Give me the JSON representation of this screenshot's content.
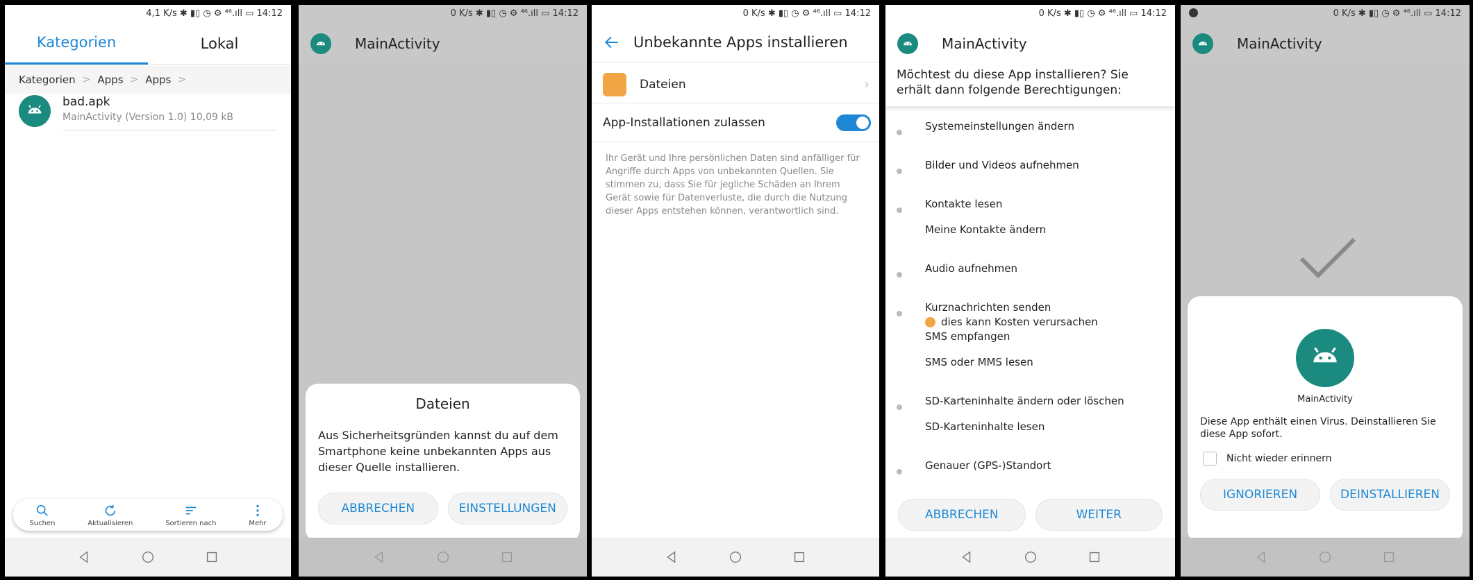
{
  "screen1": {
    "status": "4,1 K/s ✱ ▮▯ ◷ ⚙ ⁴⁶.ıll ▭ 14:12",
    "tabs": [
      "Kategorien",
      "Lokal"
    ],
    "breadcrumb": [
      "Kategorien",
      "Apps",
      "Apps"
    ],
    "file": {
      "name": "bad.apk",
      "sub": "MainActivity (Version 1.0) 10,09 kB"
    },
    "bottom": [
      "Suchen",
      "Aktualisieren",
      "Sortieren nach",
      "Mehr"
    ]
  },
  "screen2": {
    "status": "0 K/s ✱ ▮▯ ◷ ⚙ ⁴⁶.ıll ▭ 14:12",
    "title": "MainActivity",
    "dialog_title": "Dateien",
    "dialog_text": "Aus Sicherheitsgründen kannst du auf dem Smartphone keine unbekannten Apps aus dieser Quelle installieren.",
    "cancel": "ABBRECHEN",
    "settings": "EINSTELLUNGEN"
  },
  "screen3": {
    "status": "0 K/s ✱ ▮▯ ◷ ⚙ ⁴⁶.ıll ▭ 14:12",
    "title": "Unbekannte Apps installieren",
    "source": "Dateien",
    "allow": "App-Installationen zulassen",
    "allow_on": true,
    "warning": "Ihr Gerät und Ihre persönlichen Daten sind anfälliger für Angriffe durch Apps von unbekannten Quellen. Sie stimmen zu, dass Sie für jegliche Schäden an Ihrem Gerät sowie für Datenverluste, die durch die Nutzung dieser Apps entstehen können, verantwortlich sind."
  },
  "screen4": {
    "status": "0 K/s ✱ ▮▯ ◷ ⚙ ⁴⁶.ıll ▭ 14:12",
    "title": "MainActivity",
    "question": "Möchtest du diese App installieren? Sie erhält dann folgende Berechtigungen:",
    "perms": [
      "Systemeinstellungen ändern",
      "Bilder und Videos aufnehmen",
      "Kontakte lesen",
      "Meine Kontakte ändern",
      "Audio aufnehmen",
      "Kurznachrichten senden",
      "dies kann Kosten verursachen",
      "SMS empfangen",
      "SMS oder MMS lesen",
      "SD-Karteninhalte ändern oder löschen",
      "SD-Karteninhalte lesen",
      "Genauer (GPS-)Standort"
    ],
    "cancel": "ABBRECHEN",
    "next": "WEITER"
  },
  "screen5": {
    "status": "0 K/s ✱ ▮▯ ◷ ⚙ ⁴⁶.ıll ▭ 14:12",
    "title": "MainActivity",
    "app_name": "MainActivity",
    "virus_text": "Diese App enthält einen Virus. Deinstallieren Sie diese App sofort.",
    "remember": "Nicht wieder erinnern",
    "ignore": "IGNORIEREN",
    "uninstall": "DEINSTALLIEREN"
  },
  "colors": {
    "accent": "#1e88d6",
    "app_icon": "#1a8b7e",
    "overlay": "#c6c6c6"
  }
}
